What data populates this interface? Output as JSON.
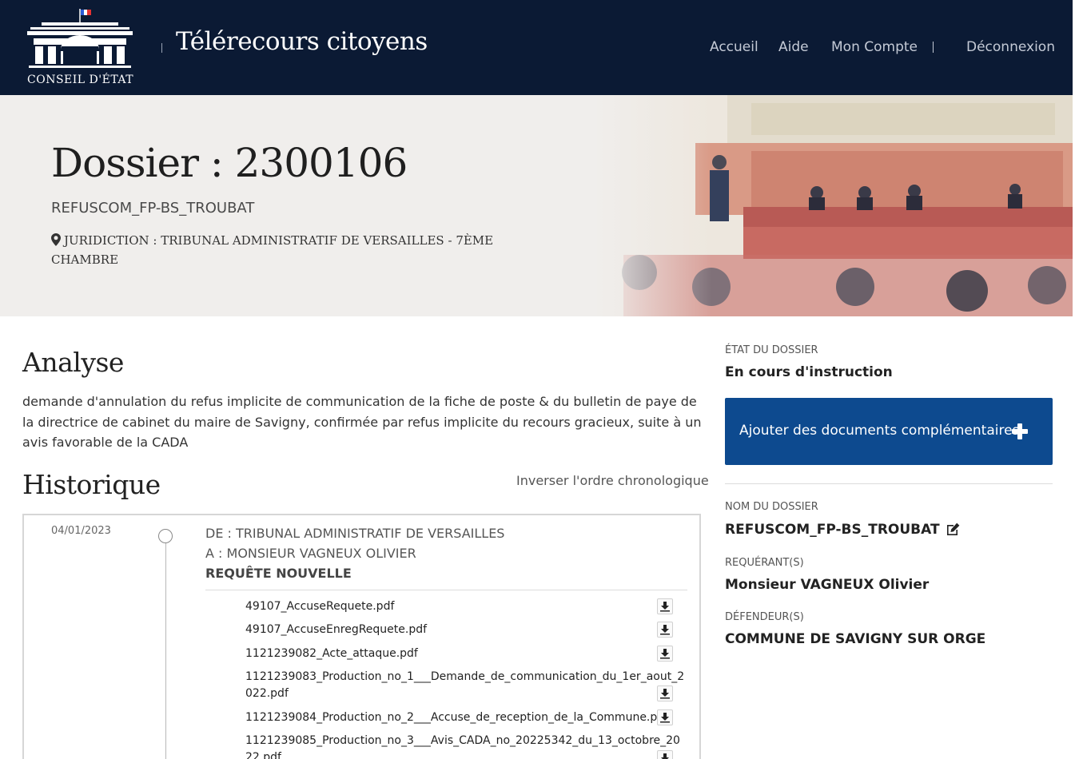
{
  "header": {
    "logo_text": "CONSEIL D'ÉTAT",
    "app_title": "Télérecours citoyens",
    "nav": [
      {
        "label": "Accueil"
      },
      {
        "label": "Aide"
      },
      {
        "label": "Mon Compte"
      },
      {
        "label": "Déconnexion"
      }
    ]
  },
  "banner": {
    "title": "Dossier : 2300106",
    "subtitle": "REFUSCOM_FP-BS_TROUBAT",
    "juridiction": "JURIDICTION : TRIBUNAL ADMINISTRATIF DE VERSAILLES - 7ÈME CHAMBRE"
  },
  "analyse": {
    "heading": "Analyse",
    "text": "demande d'annulation du refus implicite de communication de la fiche de poste & du bulletin de paye de la directrice de cabinet du maire de Savigny, confirmée par refus implicite du recours gracieux, suite à un avis favorable de la CADA"
  },
  "historique": {
    "heading": "Historique",
    "invert_label": "Inverser l'ordre chronologique",
    "entry": {
      "date": "04/01/2023",
      "de": "DE : TRIBUNAL ADMINISTRATIF DE VERSAILLES",
      "a": "A : MONSIEUR VAGNEUX OLIVIER",
      "type": "REQUÊTE NOUVELLE",
      "documents": [
        "49107_AccuseRequete.pdf",
        "49107_AccuseEnregRequete.pdf",
        "1121239082_Acte_attaque.pdf",
        "1121239083_Production_no_1___Demande_de_communication_du_1er_aout_2022.pdf",
        "1121239084_Production_no_2___Accuse_de_reception_de_la_Commune.pdf",
        "1121239085_Production_no_3___Avis_CADA_no_20225342_du_13_octobre_2022.pdf"
      ]
    }
  },
  "sidebar": {
    "etat_label": "ÉTAT DU DOSSIER",
    "etat_value": "En cours d'instruction",
    "add_button": "Ajouter des documents complémentaires",
    "nom_label": "NOM DU DOSSIER",
    "nom_value": "REFUSCOM_FP-BS_TROUBAT",
    "requerant_label": "REQUÉRANT(S)",
    "requerant_value": "Monsieur VAGNEUX Olivier",
    "defendeur_label": "DÉFENDEUR(S)",
    "defendeur_value": "COMMUNE DE SAVIGNY SUR ORGE"
  },
  "colors": {
    "header_bg": "#0b1a34",
    "banner_bg": "#f0eeec",
    "button_bg": "#0d4a8f"
  }
}
